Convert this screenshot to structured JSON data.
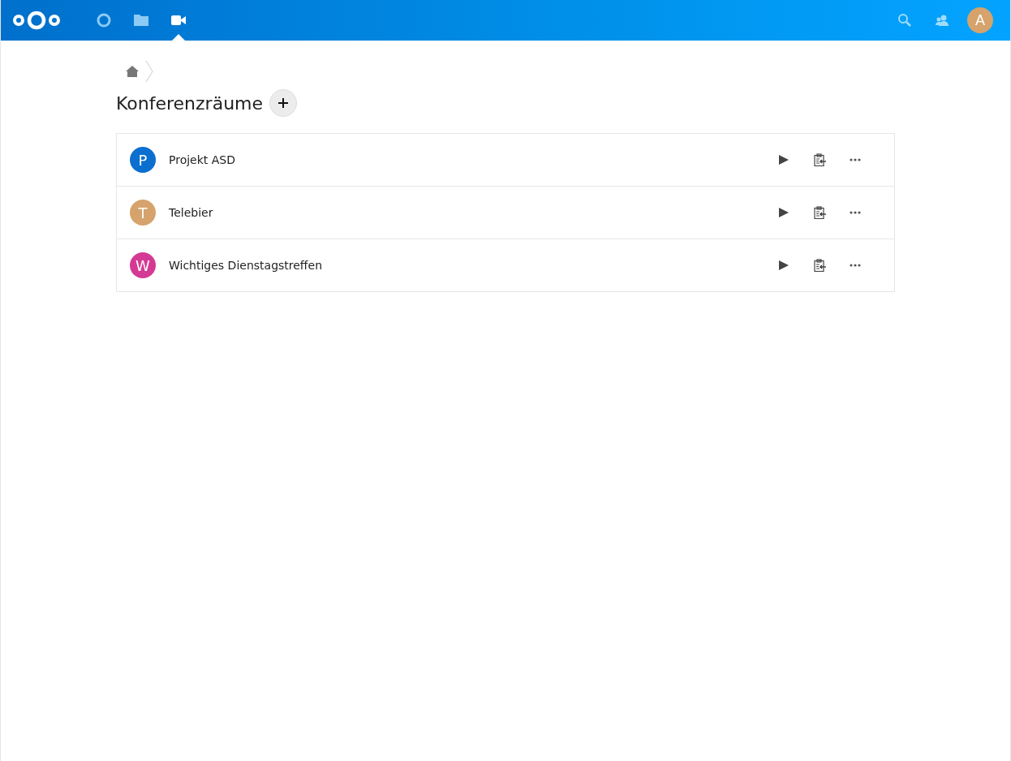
{
  "header": {
    "apps": [
      {
        "kind": "dashboard",
        "selected": false
      },
      {
        "kind": "files",
        "selected": false
      },
      {
        "kind": "video",
        "selected": true
      }
    ],
    "user_avatar": {
      "letter": "A",
      "color": "#d5a36b"
    }
  },
  "title": "Konferenzräume",
  "rooms": [
    {
      "letter": "P",
      "color": "#0a6fcf",
      "name": "Projekt ASD"
    },
    {
      "letter": "T",
      "color": "#d5a36b",
      "name": "Telebier"
    },
    {
      "letter": "W",
      "color": "#d43a94",
      "name": "Wichtiges Dienstagstreffen"
    }
  ]
}
